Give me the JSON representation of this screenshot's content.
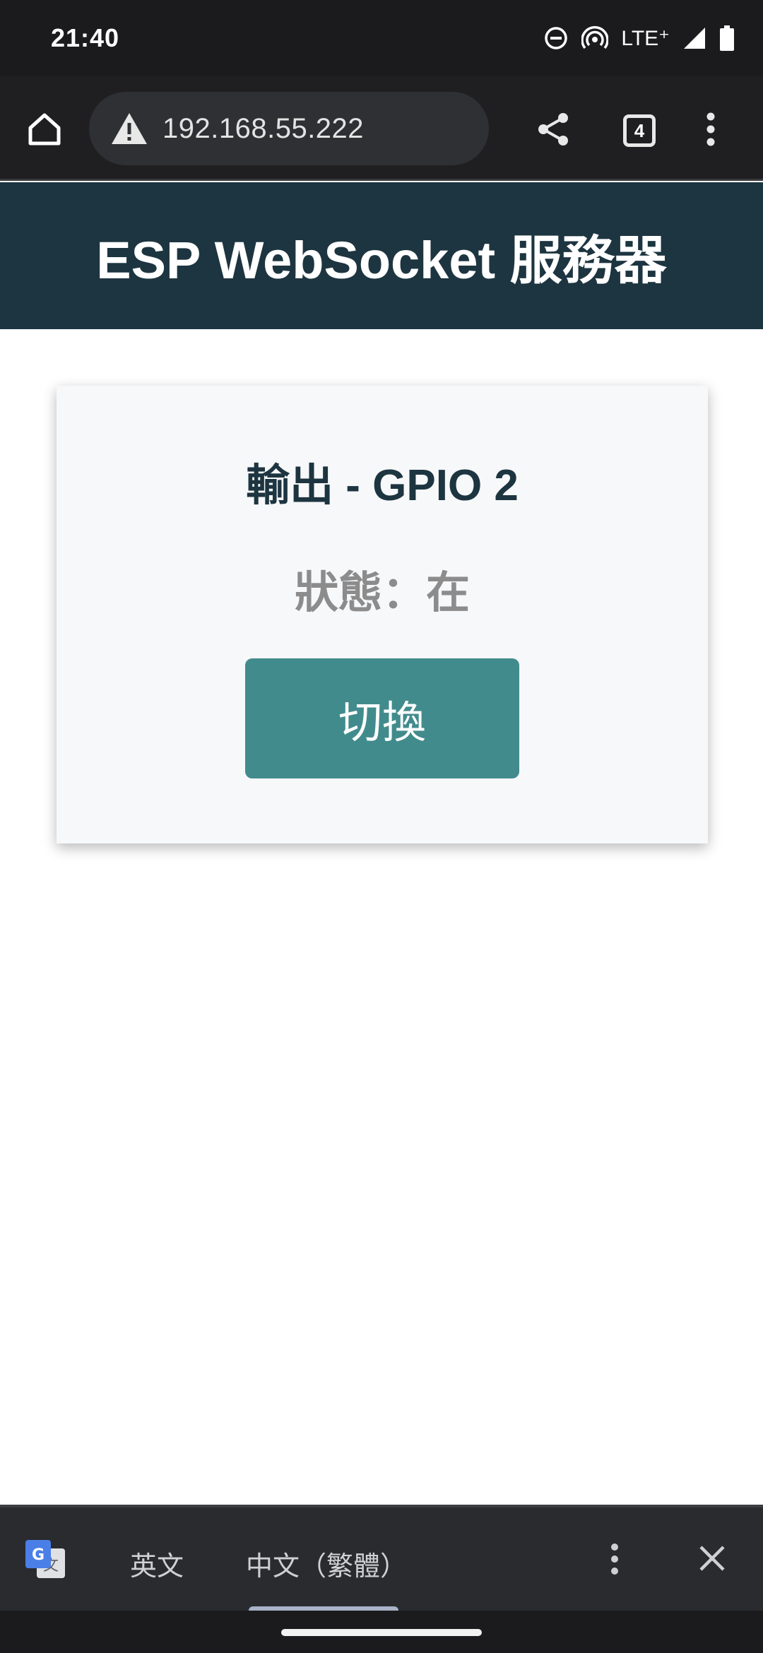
{
  "status_bar": {
    "time": "21:40",
    "network": "LTE⁺",
    "icons": [
      "do-not-disturb-icon",
      "hotspot-icon",
      "signal-icon",
      "battery-icon"
    ]
  },
  "browser": {
    "url": "192.168.55.222",
    "tab_count": "4",
    "icons": [
      "home-icon",
      "warning-icon",
      "share-icon",
      "tabs-icon",
      "more-vert-icon"
    ]
  },
  "page": {
    "title": "ESP WebSocket 服務器",
    "card": {
      "heading": "輸出 - GPIO 2",
      "state_label": "狀態：在",
      "toggle_label": "切換"
    },
    "colors": {
      "header_bg": "#1d3540",
      "button_bg": "#428b8d",
      "card_bg": "#f7f8fa",
      "state_text": "#8c8c8c"
    }
  },
  "translate_bar": {
    "source_lang": "英文",
    "target_lang": "中文（繁體）",
    "icons": [
      "google-translate-icon",
      "more-vert-icon",
      "close-icon"
    ]
  }
}
